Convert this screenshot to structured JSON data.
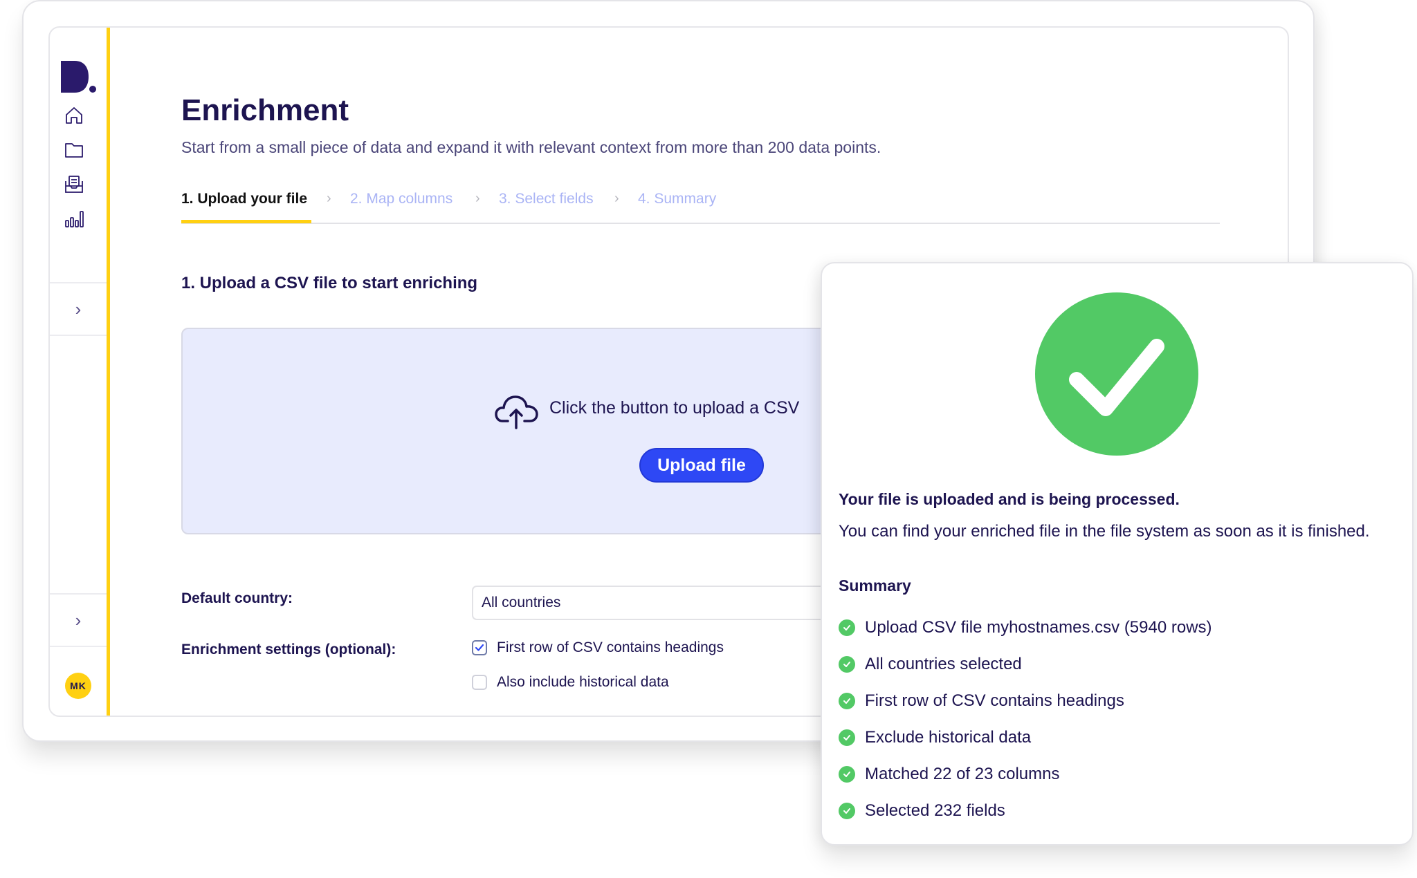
{
  "app": {
    "logo_text": "D.",
    "brand_color": "#2a1a6b",
    "accent_yellow": "#ffd012",
    "primary_blue": "#2e48f5",
    "success_green": "#52c965"
  },
  "sidebar": {
    "nav_items": [
      {
        "icon": "home-icon",
        "label": "Home"
      },
      {
        "icon": "folder-icon",
        "label": "Files"
      },
      {
        "icon": "inbox-icon",
        "label": "Inbox"
      },
      {
        "icon": "bar-chart-icon",
        "label": "Analytics"
      }
    ],
    "expand_chevron": "›",
    "avatar_initials": "MK"
  },
  "header": {
    "title": "Enrichment",
    "subtitle": "Start from a small piece of data and expand it with relevant context from more than 200 data points."
  },
  "steps": {
    "separator": "›",
    "items": [
      {
        "label": "1. Upload your file",
        "active": true
      },
      {
        "label": "2. Map columns",
        "active": false
      },
      {
        "label": "3. Select fields",
        "active": false
      },
      {
        "label": "4. Summary",
        "active": false
      }
    ]
  },
  "upload": {
    "section_title": "1. Upload a CSV file to start enriching",
    "hint": "Click the button to upload a CSV",
    "button_label": "Upload file"
  },
  "form": {
    "country_label": "Default country:",
    "country_value": "All countries",
    "settings_label": "Enrichment settings (optional):",
    "options": [
      {
        "label": "First row of CSV contains headings",
        "checked": true
      },
      {
        "label": "Also include historical data",
        "checked": false
      }
    ]
  },
  "success": {
    "title": "Your file is uploaded and is being processed.",
    "text": "You can find your enriched file in the file system as soon as it is finished.",
    "summary_title": "Summary",
    "summary_items": [
      "Upload CSV file myhostnames.csv (5940 rows)",
      "All countries selected",
      "First row of CSV contains headings",
      "Exclude historical data",
      "Matched 22 of 23 columns",
      "Selected 232 fields"
    ]
  }
}
